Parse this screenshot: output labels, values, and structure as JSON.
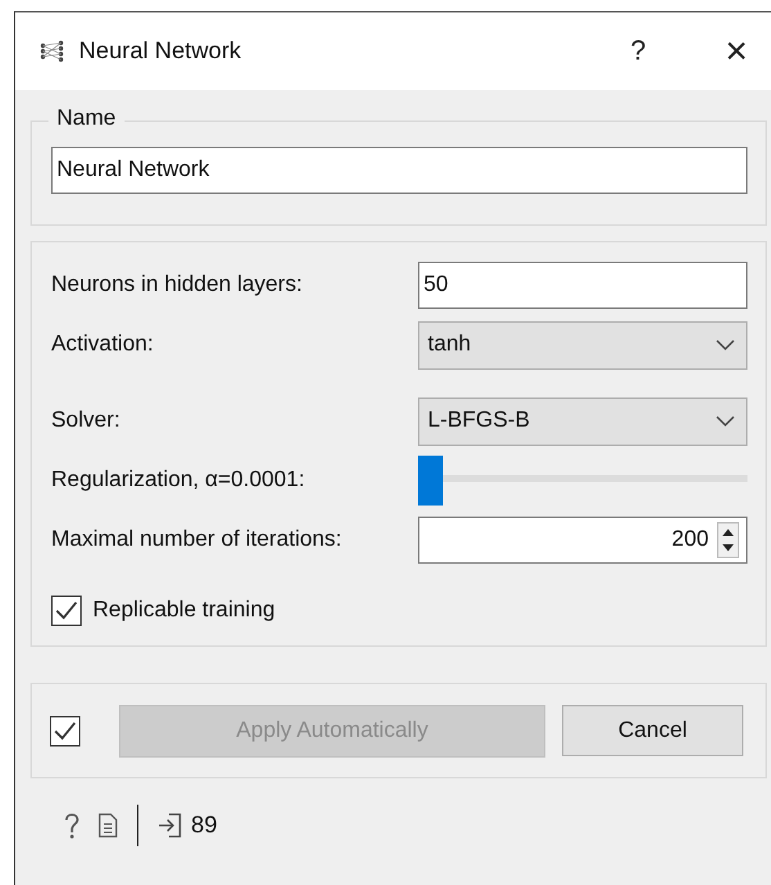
{
  "window": {
    "title": "Neural Network",
    "help": "?",
    "close": "×"
  },
  "name_group": {
    "title": "Name",
    "value": "Neural Network"
  },
  "params": [
    {
      "kind": "text",
      "label": "Neurons in hidden layers:",
      "value": "50"
    },
    {
      "kind": "combo",
      "label": "Activation:",
      "value": "tanh"
    },
    {
      "kind": "spacer"
    },
    {
      "kind": "combo",
      "label": "Solver:",
      "value": "L-BFGS-B"
    },
    {
      "kind": "slider",
      "label": "Regularization, α=0.0001:",
      "level": 0
    },
    {
      "kind": "spin",
      "label": "Maximal number of iterations:",
      "value": "200"
    },
    {
      "kind": "check",
      "label": "Replicable training",
      "checked": true
    }
  ],
  "commit": {
    "auto_checked": true,
    "apply_label": "Apply Automatically",
    "apply_disabled": true,
    "cancel_label": "Cancel"
  },
  "status_bar": {
    "count": "89"
  }
}
